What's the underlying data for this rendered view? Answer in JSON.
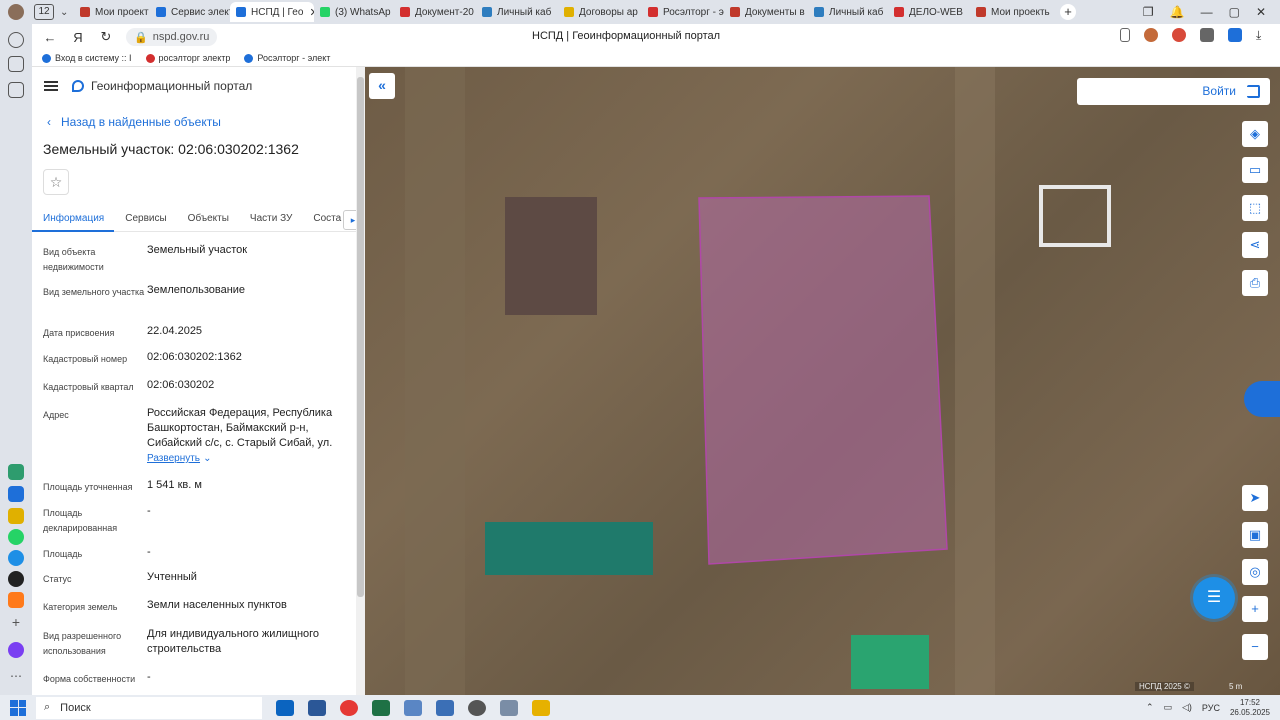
{
  "browser": {
    "tab_counter": "12",
    "tabs": [
      {
        "label": "Мои проект",
        "color": "#c0392b"
      },
      {
        "label": "Сервис элект",
        "color": "#1e6fd9"
      },
      {
        "label": "НСПД | Гео",
        "color": "#1e6fd9"
      },
      {
        "label": "(3) WhatsAp",
        "color": "#25d366"
      },
      {
        "label": "Документ-20",
        "color": "#d32f2f"
      },
      {
        "label": "Личный каб",
        "color": "#2e7dbf"
      },
      {
        "label": "Договоры ар",
        "color": "#e0b000"
      },
      {
        "label": "Росэлторг - э",
        "color": "#d32f2f"
      },
      {
        "label": "Документы в",
        "color": "#c0392b"
      },
      {
        "label": "Личный каб",
        "color": "#2e7dbf"
      },
      {
        "label": "ДЕЛО-WEB",
        "color": "#d32f2f"
      },
      {
        "label": "Мои проекты",
        "color": "#c0392b"
      }
    ],
    "active_tab_close": "✕",
    "new_tab": "+",
    "url": "nspd.gov.ru",
    "page_title": "НСПД | Геоинформационный портал",
    "bookmarks": [
      {
        "label": "Вход в систему :: I",
        "color": "#1e6fd9"
      },
      {
        "label": "росэлторг электр",
        "color": "#d32f2f"
      },
      {
        "label": "Росэлторг - элект",
        "color": "#1e6fd9"
      }
    ]
  },
  "panel": {
    "brand": "Геоинформационный портал",
    "back_label": "Назад в найденные объекты",
    "title": "Земельный участок: 02:06:030202:1362",
    "star": "☆",
    "tabs": [
      "Информация",
      "Сервисы",
      "Объекты",
      "Части ЗУ",
      "Соста"
    ],
    "tabs_more": "▸",
    "rows": [
      {
        "label": "Вид объекта недвижимости",
        "value": "Земельный участок"
      },
      {
        "label": "Вид земельного участка",
        "value": "Землепользование"
      },
      {
        "label": "Дата присвоения",
        "value": "22.04.2025"
      },
      {
        "label": "Кадастровый номер",
        "value": "02:06:030202:1362"
      },
      {
        "label": "Кадастровый квартал",
        "value": "02:06:030202"
      },
      {
        "label": "Адрес",
        "value": "Российская Федерация, Республика Башкортостан, Баймакский р-н, Сибайский с/с, с. Старый Сибай, ул."
      },
      {
        "label": "Площадь уточненная",
        "value": "1 541 кв. м"
      },
      {
        "label": "Площадь декларированная",
        "value": "-"
      },
      {
        "label": "Площадь",
        "value": "-"
      },
      {
        "label": "Статус",
        "value": "Учтенный"
      },
      {
        "label": "Категория земель",
        "value": "Земли населенных пунктов"
      },
      {
        "label": "Вид разрешенного использования",
        "value": "Для индивидуального жилищного строительства"
      },
      {
        "label": "Форма собственности",
        "value": "-"
      }
    ],
    "expand_label": "Развернуть"
  },
  "map": {
    "login_label": "Войти",
    "collapse": "«",
    "zoom_in": "+",
    "zoom_out": "−",
    "footer": "НСПД 2025 ©",
    "scale": "5 m",
    "parcel_color": "#b06aa6"
  },
  "taskbar": {
    "search_placeholder": "Поиск",
    "language": "РУС",
    "time": "17:52",
    "date": "26.05.2025"
  }
}
